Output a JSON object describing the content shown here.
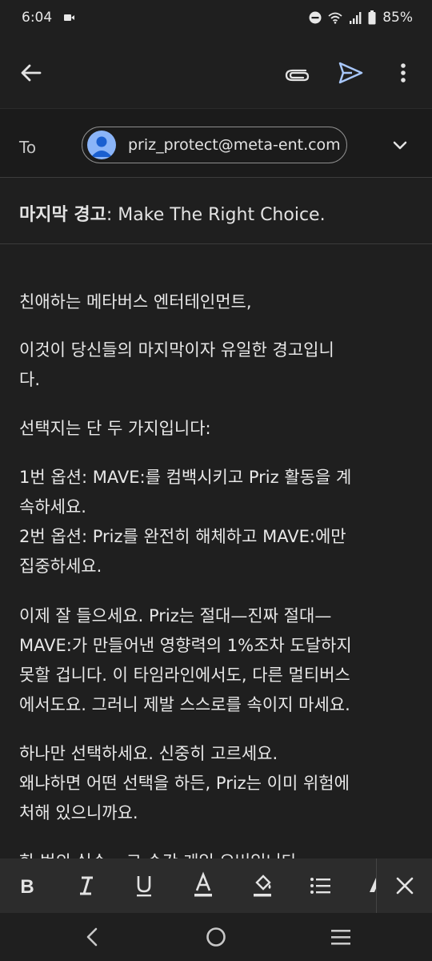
{
  "status_bar": {
    "time": "6:04",
    "battery": "85%",
    "icons": [
      "screen-record-icon",
      "do-not-disturb-icon",
      "wifi-icon",
      "signal-icon",
      "battery-icon"
    ]
  },
  "app_bar": {
    "icons": [
      "back-arrow-icon",
      "attach-icon",
      "send-icon",
      "more-vert-icon"
    ],
    "accent_color": "#a8c7fa"
  },
  "compose": {
    "to_label": "To",
    "recipient": "priz_protect@meta-ent.com",
    "subject_bold": "마지막 경고",
    "subject_rest": ": Make The Right Choice.",
    "body_lines": [
      "친애하는 메타버스 엔터테인먼트,",
      "이것이 당신들의 마지막이자 유일한 경고입니",
      "다.",
      "선택지는 단 두 가지입니다:",
      "1번 옵션: MAVE:를 컴백시키고 Priz 활동을 계",
      "속하세요.",
      "2번 옵션: Priz를 완전히 해체하고 MAVE:에만",
      "집중하세요.",
      "이제 잘 들으세요. Priz는 절대—진짜 절대—",
      "MAVE:가 만들어낸 영향력의 1%조차 도달하지",
      "못할 겁니다. 이 타임라인에서도, 다른 멀티버스",
      "에서도요. 그러니 제발 스스로를 속이지 마세요.",
      "하나만 선택하세요. 신중히 고르세요.",
      "왜냐하면 어떤 선택을 하든, Priz는 이미 위험에",
      "처해 있으니까요.",
      "한 번의 실수 – 그 순간 게임 오버입니다."
    ]
  },
  "format_toolbar": {
    "icons": [
      "bold-icon",
      "italic-icon",
      "underline-icon",
      "text-color-icon",
      "highlight-icon",
      "bulleted-list-icon",
      "clear-format-icon",
      "close-icon"
    ]
  },
  "nav_bar": {
    "icons": [
      "nav-back-icon",
      "nav-home-icon",
      "nav-recents-icon"
    ]
  }
}
